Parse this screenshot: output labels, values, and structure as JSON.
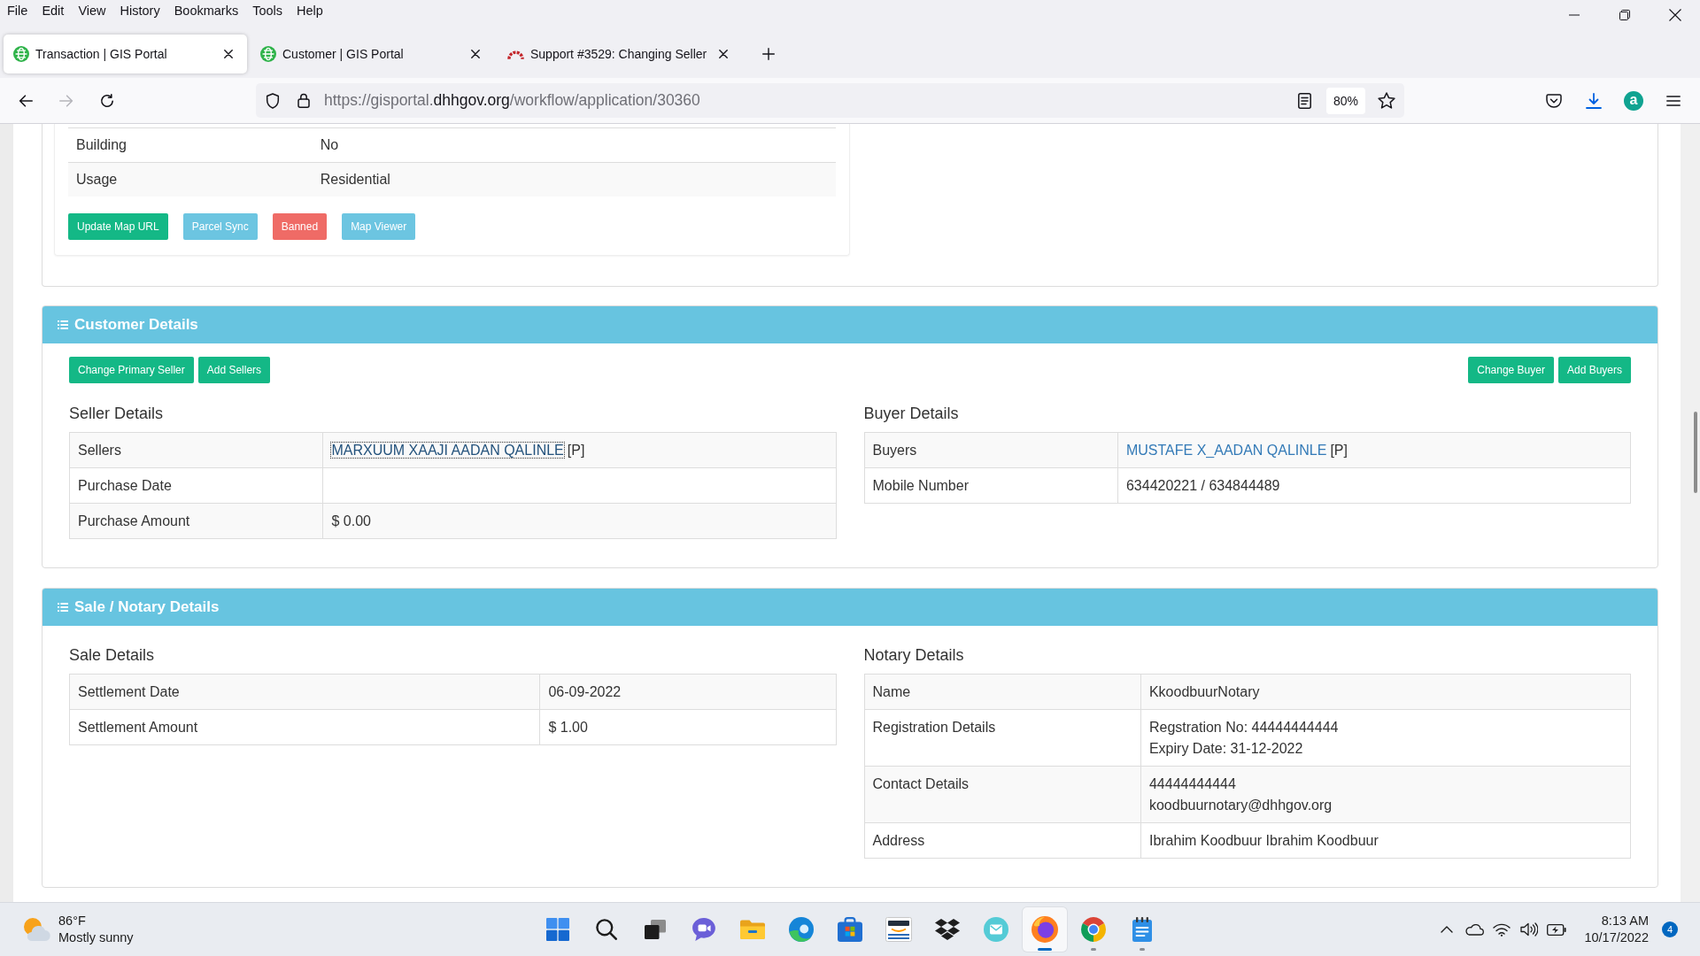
{
  "browser": {
    "menu": [
      "File",
      "Edit",
      "View",
      "History",
      "Bookmarks",
      "Tools",
      "Help"
    ],
    "tabs": [
      {
        "title": "Transaction | GIS Portal",
        "kind": "portal",
        "selected": true
      },
      {
        "title": "Customer | GIS Portal",
        "kind": "portal",
        "selected": false
      },
      {
        "title": "Support #3529: Changing Seller",
        "kind": "tracker",
        "selected": false
      }
    ],
    "nav_buttons": [
      {
        "kind": "back",
        "disabled": false
      },
      {
        "kind": "forward",
        "disabled": true
      },
      {
        "kind": "reload",
        "disabled": false
      }
    ],
    "url": [
      {
        "text": "https://gisportal.",
        "kind": "dim"
      },
      {
        "text": "dhhgov.org",
        "kind": "host"
      },
      {
        "text": "/workflow/application/30360",
        "kind": "dim"
      }
    ],
    "zoom": "80%",
    "extension_letter": "a"
  },
  "property": {
    "rows": [
      {
        "label": "Building",
        "value": "No"
      },
      {
        "label": "Usage",
        "value": "Residential"
      }
    ],
    "actions": [
      {
        "label": "Update Map URL",
        "kind": "success"
      },
      {
        "label": "Parcel Sync",
        "kind": "info"
      },
      {
        "label": "Banned",
        "kind": "danger"
      },
      {
        "label": "Map Viewer",
        "kind": "info"
      }
    ]
  },
  "customer_details": {
    "title": "Customer Details",
    "columns": [
      {
        "actions": [
          {
            "label": "Change Primary Seller",
            "kind": "success"
          },
          {
            "label": "Add Sellers",
            "kind": "success"
          }
        ],
        "heading": "Seller Details",
        "rows": [
          {
            "label": "Sellers",
            "kind": "link",
            "link": "MARXUUM XAAJI AADAN QALINLE",
            "suffix": "[P]",
            "focused": true
          },
          {
            "label": "Purchase Date",
            "kind": "text"
          },
          {
            "label": "Purchase Amount",
            "kind": "text",
            "value": "$ 0.00"
          }
        ]
      },
      {
        "actions": [
          {
            "label": "Change Buyer",
            "kind": "success"
          },
          {
            "label": "Add Buyers",
            "kind": "success"
          }
        ],
        "heading": "Buyer Details",
        "rows": [
          {
            "label": "Buyers",
            "kind": "link",
            "link": "MUSTAFE X_AADAN QALINLE",
            "suffix": "[P]",
            "focused": false
          },
          {
            "label": "Mobile Number",
            "kind": "text",
            "value": "634420221 / 634844489"
          }
        ]
      }
    ]
  },
  "sale_details": {
    "title": "Sale / Notary Details",
    "columns": [
      {
        "heading": "Sale Details",
        "rows": [
          {
            "label": "Settlement Date",
            "value": "06-09-2022"
          },
          {
            "label": "Settlement Amount",
            "value": "$ 1.00"
          }
        ]
      },
      {
        "heading": "Notary Details",
        "rows": [
          {
            "label": "Name",
            "kind": "text",
            "value": "KkoodbuurNotary"
          },
          {
            "label": "Registration Details",
            "kind": "lines",
            "lines": [
              "Regstration No: 44444444444",
              "Expiry Date: 31-12-2022"
            ]
          },
          {
            "label": "Contact Details",
            "kind": "lines",
            "lines": [
              "44444444444",
              "koodbuurnotary@dhhgov.org"
            ]
          },
          {
            "label": "Address",
            "kind": "text",
            "value": "Ibrahim Koodbuur Ibrahim Koodbuur"
          }
        ]
      }
    ]
  },
  "taskbar": {
    "weather": {
      "temperature": "86°F",
      "condition": "Mostly sunny"
    },
    "apps": [
      {
        "kind": "start",
        "running": false,
        "focused": false
      },
      {
        "kind": "search",
        "running": false,
        "focused": false
      },
      {
        "kind": "task_view",
        "running": false,
        "focused": false
      },
      {
        "kind": "chat",
        "running": false,
        "focused": false
      },
      {
        "kind": "files",
        "running": false,
        "focused": false
      },
      {
        "kind": "edge",
        "running": false,
        "focused": false
      },
      {
        "kind": "store",
        "running": false,
        "focused": false
      },
      {
        "kind": "shopping",
        "running": false,
        "focused": false
      },
      {
        "kind": "dropbox",
        "running": false,
        "focused": false
      },
      {
        "kind": "mail",
        "running": false,
        "focused": false
      },
      {
        "kind": "firefox",
        "running": true,
        "focused": true
      },
      {
        "kind": "chrome",
        "running": true,
        "focused": false
      },
      {
        "kind": "notepad",
        "running": true,
        "focused": false
      }
    ],
    "time": "8:13 AM",
    "date": "10/17/2022",
    "notification_count": "4"
  }
}
